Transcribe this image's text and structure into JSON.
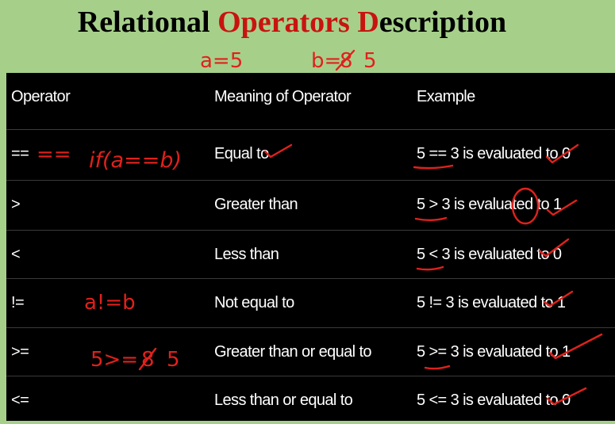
{
  "title": {
    "part1": "Relational ",
    "part2": "Operators",
    "part3": " ",
    "part4": "D",
    "part5": "escription"
  },
  "annotations": {
    "a_eq": "a=5",
    "b_eq": "b=",
    "b_struck": "8",
    "b_val": "5",
    "if_expr": "if(a==b)",
    "eq_op": "==",
    "neq": "a!=b",
    "ge_left": "5>=",
    "ge_struck": "8",
    "ge_right": "5"
  },
  "table": {
    "headers": [
      "Operator",
      "Meaning of Operator",
      "Example"
    ],
    "rows": [
      {
        "operator": "==",
        "meaning": "Equal to",
        "example": "5 == 3 is evaluated to 0"
      },
      {
        "operator": ">",
        "meaning": "Greater than",
        "example": "5 > 3 is evaluated to 1"
      },
      {
        "operator": "<",
        "meaning": "Less than",
        "example": "5 < 3 is evaluated to 0"
      },
      {
        "operator": "!=",
        "meaning": "Not equal to",
        "example": "5 != 3 is evaluated to 1"
      },
      {
        "operator": ">=",
        "meaning": "Greater than or equal to",
        "example": "5 >= 3 is evaluated to 1"
      },
      {
        "operator": "<=",
        "meaning": "Less than or equal to",
        "example": "5 <= 3 is evaluated to 0"
      }
    ]
  },
  "colors": {
    "background": "#a6d08a",
    "table": "#000000",
    "accent_red": "#c8140f",
    "ink": "#e0211c"
  }
}
